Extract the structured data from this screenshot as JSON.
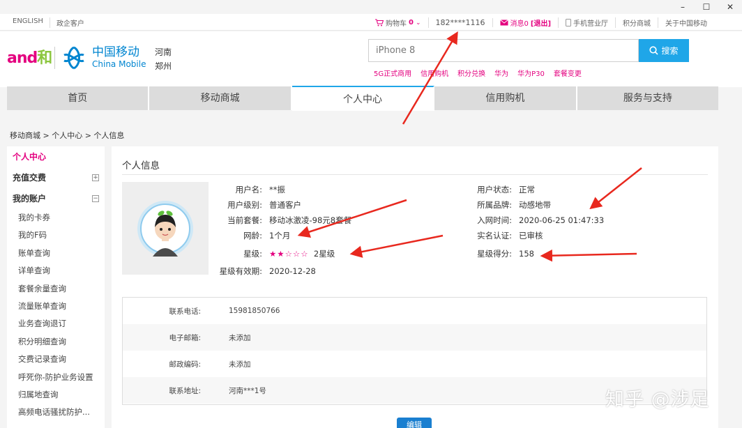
{
  "window": {
    "minimize": "–",
    "maximize": "☐",
    "close": "✕"
  },
  "topbar": {
    "lang": "ENGLISH",
    "gov": "政企客户",
    "cart_label": "购物车",
    "cart_count": "0",
    "phone": "182****1116",
    "msg_label": "消息0",
    "logout": "[退出]",
    "mobile_hall": "手机营业厅",
    "points_mall": "积分商城",
    "about": "关于中国移动"
  },
  "header": {
    "brand_and": "and",
    "brand_he": "和",
    "cm_cn": "中国移动",
    "cm_en": "China Mobile",
    "province": "河南",
    "city": "郑州",
    "search_value": "iPhone 8",
    "search_btn": "搜索",
    "hot_links": [
      "5G正式商用",
      "信用购机",
      "积分兑换",
      "华为",
      "华为P30",
      "套餐变更"
    ]
  },
  "nav": [
    "首页",
    "移动商城",
    "个人中心",
    "信用购机",
    "服务与支持"
  ],
  "breadcrumb": "移动商城 >  个人中心 > 个人信息",
  "sidebar": {
    "head": "个人中心",
    "group1": "充值交费",
    "group1_toggle": "+",
    "group2": "我的账户",
    "group2_toggle": "−",
    "items": [
      "我的卡券",
      "我的F码",
      "账单查询",
      "详单查询",
      "套餐余量查询",
      "流量账单查询",
      "业务查询退订",
      "积分明细查询",
      "交费记录查询",
      "呼死你-防护业务设置",
      "归属地查询",
      "高频电话骚扰防护..."
    ]
  },
  "profile": {
    "title": "个人信息",
    "left": [
      {
        "label": "用户名:",
        "value": "**振"
      },
      {
        "label": "用户级别:",
        "value": "普通客户"
      },
      {
        "label": "当前套餐:",
        "value": "移动冰激凌-98元8套餐"
      },
      {
        "label": "网龄:",
        "value": "1个月"
      },
      {
        "label": "星级:",
        "value": "2星级"
      },
      {
        "label": "星级有效期:",
        "value": "2020-12-28"
      }
    ],
    "right": [
      {
        "label": "用户状态:",
        "value": "正常"
      },
      {
        "label": "所属品牌:",
        "value": "动感地带"
      },
      {
        "label": "入网时间:",
        "value": "2020-06-25 01:47:33"
      },
      {
        "label": "实名认证:",
        "value": "已审核"
      },
      {
        "label": "星级得分:",
        "value": "158"
      }
    ],
    "stars_on": "★★",
    "stars_off": "☆☆☆",
    "star_rating": 2,
    "star_max": 5
  },
  "contact": [
    {
      "label": "联系电话:",
      "value": "15981850766"
    },
    {
      "label": "电子邮箱:",
      "value": "未添加"
    },
    {
      "label": "邮政编码:",
      "value": "未添加"
    },
    {
      "label": "联系地址:",
      "value": "河南***1号"
    }
  ],
  "edit_btn": "编辑",
  "watermark": "知乎 @涉足",
  "colors": {
    "accent": "#1fa6e8",
    "brand_pink": "#e4007f",
    "arrow_red": "#e8281e"
  }
}
